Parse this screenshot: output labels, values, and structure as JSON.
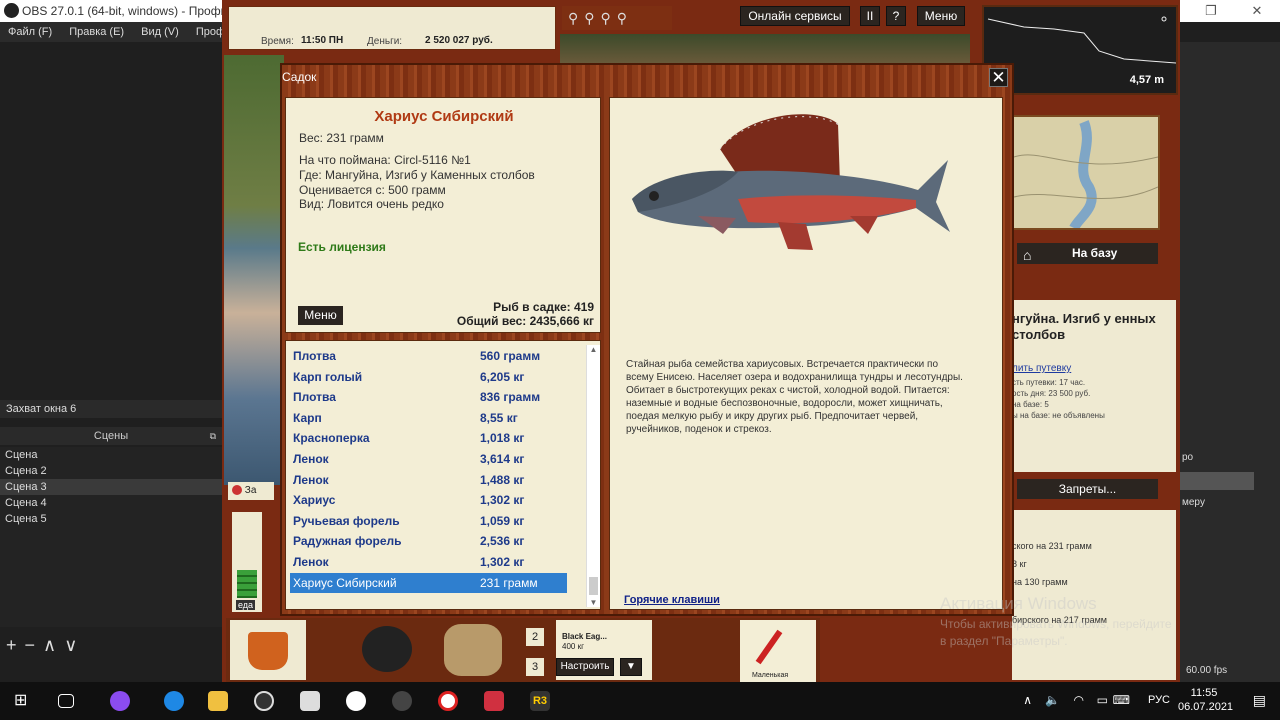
{
  "obs": {
    "title": "OBS 27.0.1 (64-bit, windows) - Профил",
    "menu": [
      "Файл (F)",
      "Правка (E)",
      "Вид (V)",
      "Профи"
    ],
    "capture_label": "Захват окна 6",
    "scenes_header": "Сцены",
    "scenes": [
      "Сцена",
      "Сцена 2",
      "Сцена 3",
      "Сцена 4",
      "Сцена 5"
    ],
    "selected_scene": "Сцена 3",
    "right_items": [
      "ро",
      "мерy"
    ],
    "fps": "60.00 fps"
  },
  "watermark": {
    "title": "Активация Windows",
    "text": "Чтобы активировать Windows, перейдите в раздел \"Параметры\"."
  },
  "game": {
    "time_label": "Время:",
    "time_value": "11:50 ПН",
    "money_label": "Деньги:",
    "money_value": "2 520 027 руб.",
    "online_services": "Онлайн сервисы",
    "pause": "II",
    "help": "?",
    "menu": "Меню",
    "depth": "4,57 m",
    "to_base": "На базу",
    "location": "Мангуйна. Изгиб у Каменных столбов",
    "location_visible": "нгуйна. Изгиб у енных столбов",
    "buy_permit": "лить путевку",
    "permit_lines": [
      "сть путевки: 17 час.",
      "ость дня: 23 500 руб.",
      "на базе: 5",
      "ы на базе: не объявлены"
    ],
    "bans": "Запреты...",
    "news": [
      "ского на 231 грамм",
      "8 кг",
      "на 130 грамм",
      "бирского на 217 грамм"
    ],
    "food_label": "еда",
    "bait_name": "Black Eag...",
    "bait_weight": "400 кг",
    "setup_button": "Настроить",
    "slot_numbers": [
      "2",
      "3"
    ],
    "lure_label": "Маленькая",
    "left_badge": "За"
  },
  "dialog": {
    "title": "Садок",
    "close": "✕",
    "fish": {
      "name": "Хариус Сибирский",
      "weight": "Вес: 231 грамм",
      "caught_on": "На что поймана: Circl-5116 №1",
      "where": "Где: Мангуйна, Изгиб у Каменных столбов",
      "valued_from": "Оценивается с: 500 грамм",
      "kind": "Вид: Ловится очень редко",
      "license": "Есть лицензия"
    },
    "menu_button": "Меню",
    "fish_in_cage": "Рыб в садке: 419",
    "total_weight": "Общий вес: 2435,666 кг",
    "list": [
      {
        "name": "Плотва",
        "weight": "560 грамм"
      },
      {
        "name": "Карп голый",
        "weight": "6,205 кг"
      },
      {
        "name": "Плотва",
        "weight": "836 грамм"
      },
      {
        "name": "Карп",
        "weight": "8,55 кг"
      },
      {
        "name": "Красноперка",
        "weight": "1,018 кг"
      },
      {
        "name": "Ленок",
        "weight": "3,614 кг"
      },
      {
        "name": "Ленок",
        "weight": "1,488 кг"
      },
      {
        "name": "Хариус",
        "weight": "1,302 кг"
      },
      {
        "name": "Ручьевая форель",
        "weight": "1,059 кг"
      },
      {
        "name": "Радужная форель",
        "weight": "2,536 кг"
      },
      {
        "name": "Ленок",
        "weight": "1,302 кг"
      },
      {
        "name": "Хариус Сибирский",
        "weight": "231 грамм"
      }
    ],
    "selected_index": 11,
    "description": "Стайная рыба семейства хариусовых. Встречается практически по всему Енисею. Населяет озера и водохранилища тундры и лесотундры. Обитает в быстротекущих реках с чистой, холодной водой. Питается: наземные и водные беспозвоночные, водоросли, может хищничать, поедая мелкую рыбу и икру других рыб. Предпочитает червей, ручейников, поденок и стрекоз.",
    "hotkeys": "Горячие клавиши"
  },
  "taskbar": {
    "lang": "РУС",
    "time": "11:55",
    "date": "06.07.2021"
  },
  "colors": {
    "selected_row": "#2f7fcf",
    "fish_list_text": "#1e3a8a",
    "fish_name": "#b03a14",
    "license": "#2e7a18",
    "wood": "#7a2a12"
  }
}
